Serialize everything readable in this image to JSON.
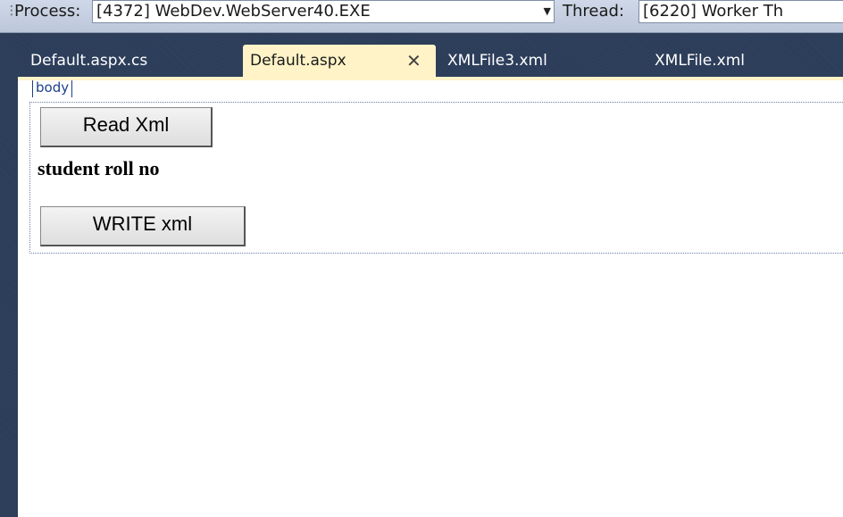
{
  "toolbar": {
    "process_label": "Process:",
    "process_value": "[4372] WebDev.WebServer40.EXE",
    "thread_label": "Thread:",
    "thread_value": "[6220] Worker Th"
  },
  "tabs": [
    {
      "label": "Default.aspx.cs",
      "active": false
    },
    {
      "label": "Default.aspx",
      "active": true
    },
    {
      "label": "XMLFile3.xml",
      "active": false
    },
    {
      "label": "XMLFile.xml",
      "active": false
    }
  ],
  "designer": {
    "body_tag": "body",
    "read_button": "Read Xml",
    "label_text": "student roll no",
    "write_button": "WRITE xml"
  },
  "colors": {
    "active_tab": "#fff3c7",
    "ide_background": "#2b3c59",
    "tag_color": "#1b3f8b"
  }
}
